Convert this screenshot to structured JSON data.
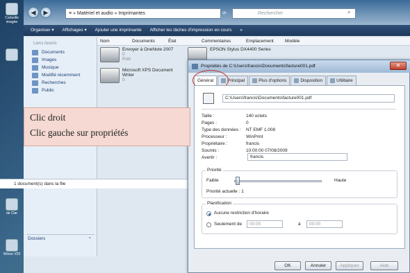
{
  "desktop": {
    "icons": [
      {
        "label": "Corbeille imagée",
        "name": "corbeille"
      },
      {
        "label": "",
        "name": "app"
      },
      {
        "label": "de Clar",
        "name": "shortcut"
      },
      {
        "label": "Winne V20",
        "name": "program"
      }
    ]
  },
  "explorer": {
    "address": "≡ » Matériel et audio » Imprimantes",
    "search_placeholder": "Rechercher",
    "toolbar": {
      "organize": "Organiser ▾",
      "views": "Affichages ▾",
      "add_printer": "Ajouter une imprimante",
      "show_tasks": "Afficher les tâches d'impression en cours",
      "more": "»"
    },
    "nav_header": "Liens favoris",
    "nav_items": [
      "Documents",
      "Images",
      "Musique",
      "Modifié récemment",
      "Recherches",
      "Public"
    ],
    "dossiers": "Dossiers",
    "columns": [
      "Nom",
      "Documents",
      "État",
      "Commentaires",
      "Emplacement",
      "Modèle"
    ],
    "printers": [
      {
        "name": "Envoyer à OneNote 2007",
        "line2": "0",
        "line3": "Prêt"
      },
      {
        "name": "EPSON Stylus DX4400 Series",
        "line2": "",
        "line3": ""
      },
      {
        "name": "Microsoft XPS Document Writer",
        "line2": "0",
        "line3": ""
      }
    ],
    "status": "1 document(s) dans la file"
  },
  "properties": {
    "title": "Propriétés de C:\\Users\\francis\\Documents\\facture001.pdf",
    "tabs": [
      "Général",
      "Principal",
      "Plus d'options",
      "Disposition",
      "Utilitaire"
    ],
    "active_tab": "Général",
    "path": "C:\\Users\\francis\\Documents\\facture001.pdf",
    "rows": [
      {
        "label": "Taille :",
        "value": "140 octets"
      },
      {
        "label": "Pages :",
        "value": "0"
      },
      {
        "label": "Type des données :",
        "value": "NT EMF 1.008"
      },
      {
        "label": "Processeur :",
        "value": "WinPrint"
      },
      {
        "label": "Propriétaire :",
        "value": "francis"
      },
      {
        "label": "Soumis :",
        "value": "10:00:00  07/08/2009"
      }
    ],
    "avertir_label": "Avertir :",
    "avertir_value": "francis",
    "priority": {
      "group_label": "Priorité",
      "low": "Faible",
      "high": "Haute",
      "current": "Priorité actuelle :  1"
    },
    "schedule": {
      "group_label": "Planification",
      "option1": "Aucune restriction d'horaire",
      "option2": "Seulement de",
      "from": "00:00",
      "to_label": "à",
      "to": "00:00"
    },
    "buttons": {
      "ok": "OK",
      "cancel": "Annuler",
      "apply": "Appliquer",
      "help": "Aide"
    }
  },
  "annotation": {
    "line1": "Clic droit",
    "line2": "Clic gauche sur propriétés",
    "highlight_color": "#c0392b"
  }
}
